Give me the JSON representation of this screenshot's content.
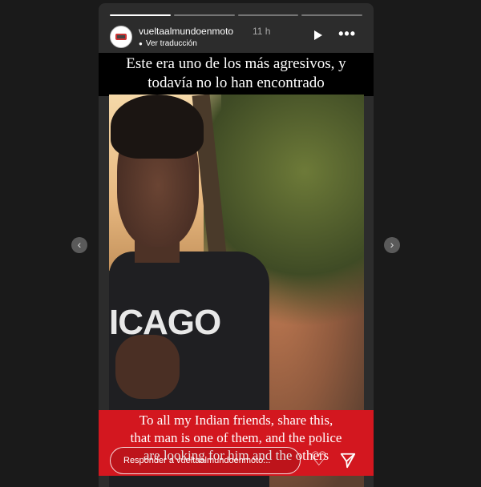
{
  "story": {
    "username": "vueltaalmundoenmoto",
    "time": "11 h",
    "translate_label": "Ver traducción",
    "progress_segments": 4,
    "active_segment": 1,
    "caption_top": [
      "Este era uno de los más agresivos, y",
      "todavía no lo han encontrado"
    ],
    "caption_bottom": [
      "To all my Indian friends, share this,",
      "that man is one of them, and the police",
      "are looking for him and the others"
    ],
    "shirt_text": "ICAGO",
    "reply_placeholder": "Responder a vueltaalmundoenmoto...",
    "icons": {
      "play": "play-icon",
      "more": "more-options-icon",
      "heart": "heart-icon",
      "send": "send-icon",
      "prev": "chevron-left-icon",
      "next": "chevron-right-icon"
    },
    "colors": {
      "caption_bottom_bg": "#d3171f",
      "caption_top_bg": "#000000"
    }
  },
  "nav": {
    "prev_label": "‹",
    "next_label": "›"
  }
}
